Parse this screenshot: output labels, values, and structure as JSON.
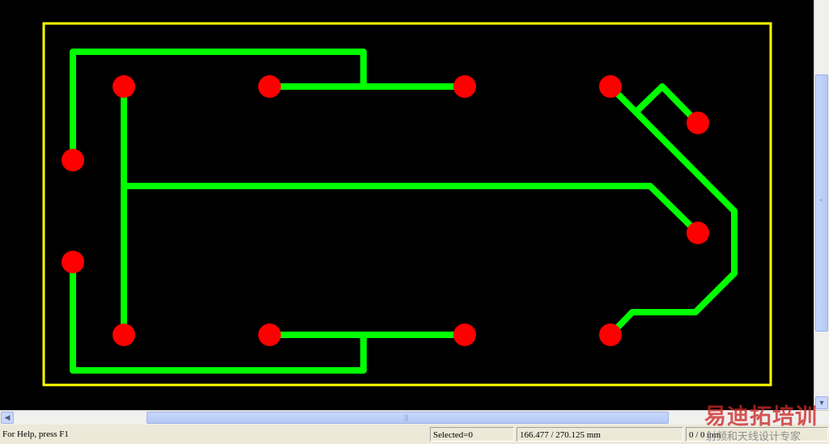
{
  "colors": {
    "canvas_background": "#000000",
    "board_outline": "#ffff00",
    "track": "#00ff00",
    "pad": "#ff0000"
  },
  "icons": {
    "scroll_left": "arrow-left-icon",
    "scroll_down": "arrow-down-icon"
  },
  "status_bar": {
    "help_text": "For Help, press F1",
    "selected_text": "Selected=0",
    "coordinates_text": "166.477 / 270.125 mm",
    "delta_text": "0 / 0 mm"
  },
  "watermark": {
    "brand_text": "易迪拓培训",
    "tagline_text": "射频和天线设计专家"
  }
}
